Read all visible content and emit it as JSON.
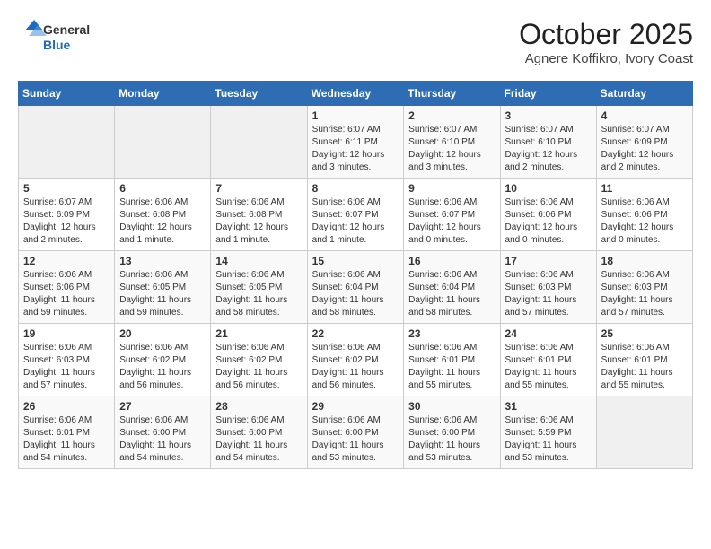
{
  "header": {
    "logo_general": "General",
    "logo_blue": "Blue",
    "month_year": "October 2025",
    "location": "Agnere Koffikro, Ivory Coast"
  },
  "days_of_week": [
    "Sunday",
    "Monday",
    "Tuesday",
    "Wednesday",
    "Thursday",
    "Friday",
    "Saturday"
  ],
  "weeks": [
    [
      {
        "day": "",
        "empty": true
      },
      {
        "day": "",
        "empty": true
      },
      {
        "day": "",
        "empty": true
      },
      {
        "day": "1",
        "sunrise": "Sunrise: 6:07 AM",
        "sunset": "Sunset: 6:11 PM",
        "daylight": "Daylight: 12 hours and 3 minutes."
      },
      {
        "day": "2",
        "sunrise": "Sunrise: 6:07 AM",
        "sunset": "Sunset: 6:10 PM",
        "daylight": "Daylight: 12 hours and 3 minutes."
      },
      {
        "day": "3",
        "sunrise": "Sunrise: 6:07 AM",
        "sunset": "Sunset: 6:10 PM",
        "daylight": "Daylight: 12 hours and 2 minutes."
      },
      {
        "day": "4",
        "sunrise": "Sunrise: 6:07 AM",
        "sunset": "Sunset: 6:09 PM",
        "daylight": "Daylight: 12 hours and 2 minutes."
      }
    ],
    [
      {
        "day": "5",
        "sunrise": "Sunrise: 6:07 AM",
        "sunset": "Sunset: 6:09 PM",
        "daylight": "Daylight: 12 hours and 2 minutes."
      },
      {
        "day": "6",
        "sunrise": "Sunrise: 6:06 AM",
        "sunset": "Sunset: 6:08 PM",
        "daylight": "Daylight: 12 hours and 1 minute."
      },
      {
        "day": "7",
        "sunrise": "Sunrise: 6:06 AM",
        "sunset": "Sunset: 6:08 PM",
        "daylight": "Daylight: 12 hours and 1 minute."
      },
      {
        "day": "8",
        "sunrise": "Sunrise: 6:06 AM",
        "sunset": "Sunset: 6:07 PM",
        "daylight": "Daylight: 12 hours and 1 minute."
      },
      {
        "day": "9",
        "sunrise": "Sunrise: 6:06 AM",
        "sunset": "Sunset: 6:07 PM",
        "daylight": "Daylight: 12 hours and 0 minutes."
      },
      {
        "day": "10",
        "sunrise": "Sunrise: 6:06 AM",
        "sunset": "Sunset: 6:06 PM",
        "daylight": "Daylight: 12 hours and 0 minutes."
      },
      {
        "day": "11",
        "sunrise": "Sunrise: 6:06 AM",
        "sunset": "Sunset: 6:06 PM",
        "daylight": "Daylight: 12 hours and 0 minutes."
      }
    ],
    [
      {
        "day": "12",
        "sunrise": "Sunrise: 6:06 AM",
        "sunset": "Sunset: 6:06 PM",
        "daylight": "Daylight: 11 hours and 59 minutes."
      },
      {
        "day": "13",
        "sunrise": "Sunrise: 6:06 AM",
        "sunset": "Sunset: 6:05 PM",
        "daylight": "Daylight: 11 hours and 59 minutes."
      },
      {
        "day": "14",
        "sunrise": "Sunrise: 6:06 AM",
        "sunset": "Sunset: 6:05 PM",
        "daylight": "Daylight: 11 hours and 58 minutes."
      },
      {
        "day": "15",
        "sunrise": "Sunrise: 6:06 AM",
        "sunset": "Sunset: 6:04 PM",
        "daylight": "Daylight: 11 hours and 58 minutes."
      },
      {
        "day": "16",
        "sunrise": "Sunrise: 6:06 AM",
        "sunset": "Sunset: 6:04 PM",
        "daylight": "Daylight: 11 hours and 58 minutes."
      },
      {
        "day": "17",
        "sunrise": "Sunrise: 6:06 AM",
        "sunset": "Sunset: 6:03 PM",
        "daylight": "Daylight: 11 hours and 57 minutes."
      },
      {
        "day": "18",
        "sunrise": "Sunrise: 6:06 AM",
        "sunset": "Sunset: 6:03 PM",
        "daylight": "Daylight: 11 hours and 57 minutes."
      }
    ],
    [
      {
        "day": "19",
        "sunrise": "Sunrise: 6:06 AM",
        "sunset": "Sunset: 6:03 PM",
        "daylight": "Daylight: 11 hours and 57 minutes."
      },
      {
        "day": "20",
        "sunrise": "Sunrise: 6:06 AM",
        "sunset": "Sunset: 6:02 PM",
        "daylight": "Daylight: 11 hours and 56 minutes."
      },
      {
        "day": "21",
        "sunrise": "Sunrise: 6:06 AM",
        "sunset": "Sunset: 6:02 PM",
        "daylight": "Daylight: 11 hours and 56 minutes."
      },
      {
        "day": "22",
        "sunrise": "Sunrise: 6:06 AM",
        "sunset": "Sunset: 6:02 PM",
        "daylight": "Daylight: 11 hours and 56 minutes."
      },
      {
        "day": "23",
        "sunrise": "Sunrise: 6:06 AM",
        "sunset": "Sunset: 6:01 PM",
        "daylight": "Daylight: 11 hours and 55 minutes."
      },
      {
        "day": "24",
        "sunrise": "Sunrise: 6:06 AM",
        "sunset": "Sunset: 6:01 PM",
        "daylight": "Daylight: 11 hours and 55 minutes."
      },
      {
        "day": "25",
        "sunrise": "Sunrise: 6:06 AM",
        "sunset": "Sunset: 6:01 PM",
        "daylight": "Daylight: 11 hours and 55 minutes."
      }
    ],
    [
      {
        "day": "26",
        "sunrise": "Sunrise: 6:06 AM",
        "sunset": "Sunset: 6:01 PM",
        "daylight": "Daylight: 11 hours and 54 minutes."
      },
      {
        "day": "27",
        "sunrise": "Sunrise: 6:06 AM",
        "sunset": "Sunset: 6:00 PM",
        "daylight": "Daylight: 11 hours and 54 minutes."
      },
      {
        "day": "28",
        "sunrise": "Sunrise: 6:06 AM",
        "sunset": "Sunset: 6:00 PM",
        "daylight": "Daylight: 11 hours and 54 minutes."
      },
      {
        "day": "29",
        "sunrise": "Sunrise: 6:06 AM",
        "sunset": "Sunset: 6:00 PM",
        "daylight": "Daylight: 11 hours and 53 minutes."
      },
      {
        "day": "30",
        "sunrise": "Sunrise: 6:06 AM",
        "sunset": "Sunset: 6:00 PM",
        "daylight": "Daylight: 11 hours and 53 minutes."
      },
      {
        "day": "31",
        "sunrise": "Sunrise: 6:06 AM",
        "sunset": "Sunset: 5:59 PM",
        "daylight": "Daylight: 11 hours and 53 minutes."
      },
      {
        "day": "",
        "empty": true
      }
    ]
  ]
}
